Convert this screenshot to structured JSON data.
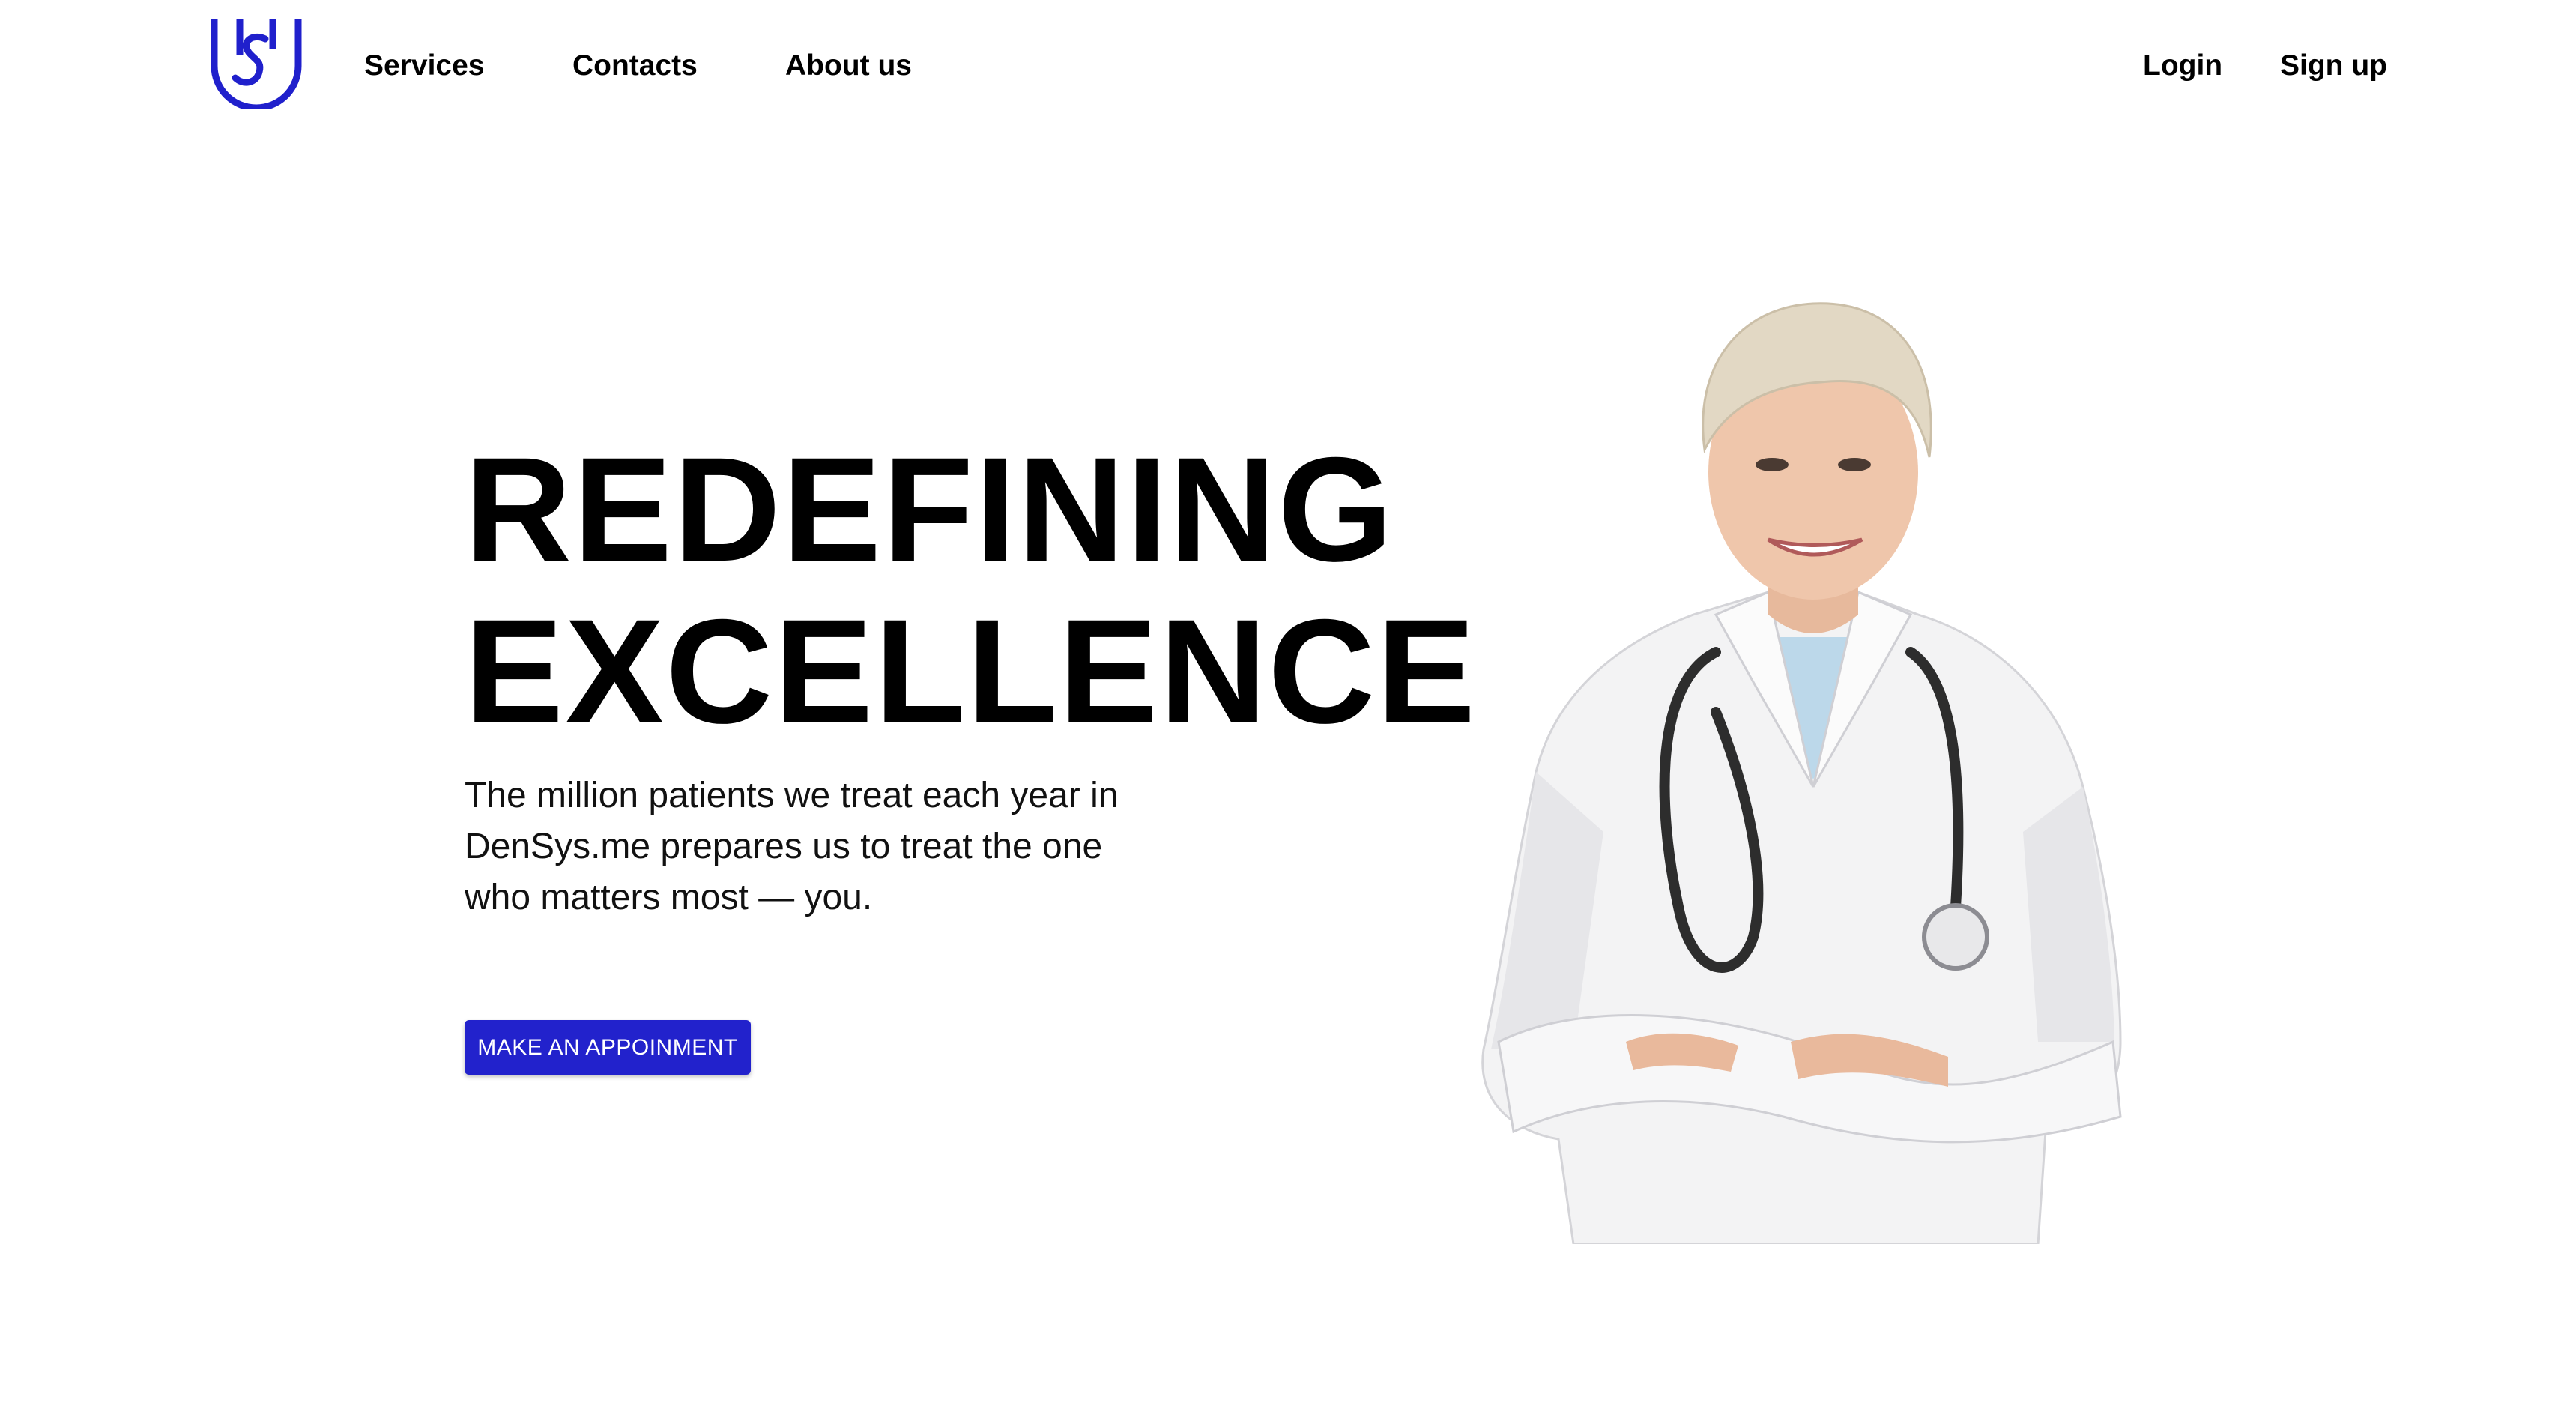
{
  "brand": {
    "logo_icon": "shield-s-logo-icon",
    "color": "#2020cc"
  },
  "nav": {
    "links": [
      "Services",
      "Contacts",
      "About us"
    ],
    "login": "Login",
    "signup": "Sign up"
  },
  "hero": {
    "title_line_1": "REDEFINING",
    "title_line_2": "EXCELLENCE",
    "text": "The million patients we treat each year in DenSys.me prepares us to treat the one who matters most — you.",
    "cta_label": "MAKE AN APPOINMENT",
    "cta_color": "#2222cc",
    "image": "doctor-photo"
  }
}
